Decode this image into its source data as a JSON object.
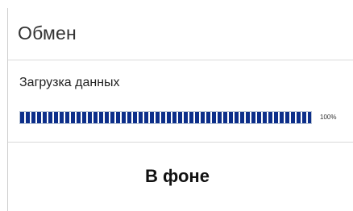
{
  "dialog": {
    "title": "Обмен",
    "status_text": "Загрузка данных",
    "progress": {
      "percent": 100,
      "label": "100%"
    },
    "background_button_label": "В фоне"
  },
  "colors": {
    "progress_fill": "#0d2f8a",
    "divider": "#d9d9d9"
  }
}
